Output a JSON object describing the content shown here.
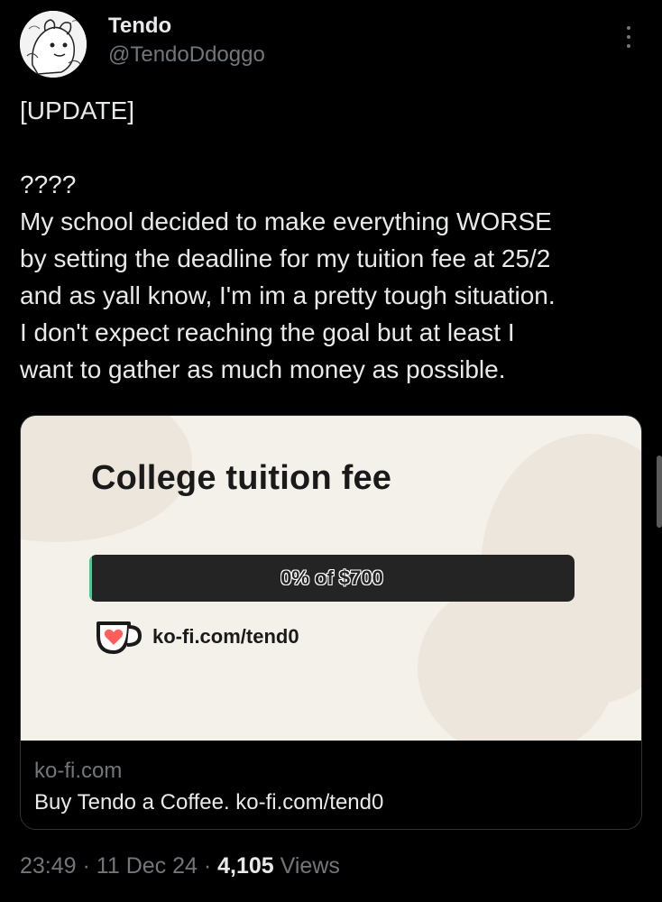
{
  "author": {
    "name": "Tendo",
    "handle": "@TendoDdoggo",
    "avatar_icon": "doodle-avatar"
  },
  "more_icon": "more-vertical-icon",
  "tweet": {
    "line1": "[UPDATE]",
    "line2": "????",
    "line3": "My school decided to make everything WORSE",
    "line4": "by setting the deadline for my tuition fee at 25/2",
    "line5": "and as yall know, I'm im a pretty tough situation.",
    "line6": "I don't expect reaching the goal but at least I",
    "line7": "want to gather as much money as possible."
  },
  "card": {
    "goal_title": "College tuition fee",
    "progress_percent": 0,
    "progress_text": "0% of $700",
    "kofi_url": "ko-fi.com/tend0",
    "domain": "ko-fi.com",
    "title": "Buy Tendo a Coffee. ko-fi.com/tend0",
    "colors": {
      "card_bg": "#f4f0ea",
      "progress_bg": "#242424",
      "progress_fill": "#3fcf8e",
      "kofi_cup": "#ff5e5b"
    }
  },
  "meta": {
    "time": "23:49",
    "separator": "·",
    "date": "11 Dec 24",
    "views_count": "4,105",
    "views_label": "Views"
  }
}
